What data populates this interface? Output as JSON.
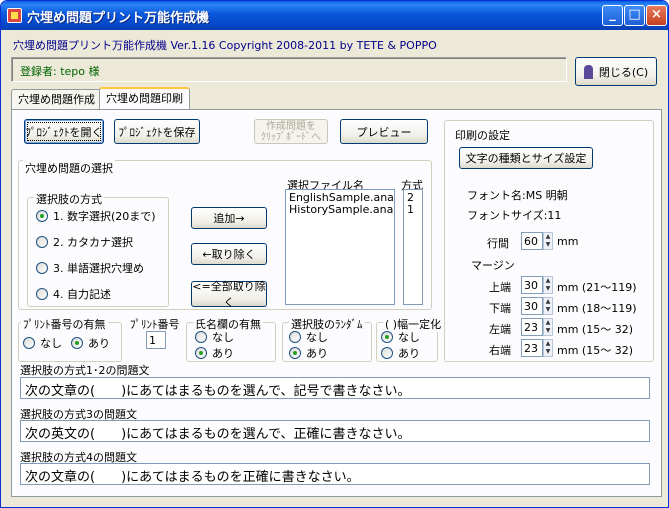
{
  "window": {
    "title": "穴埋め問題プリント万能作成機"
  },
  "header": {
    "line": "穴埋め問題プリント万能作成機 Ver.1.16  Copyright 2008-2011 by TETE & POPPO",
    "registered": "登録者: tepo 様",
    "close_button": "閉じる(C)"
  },
  "tabs": [
    {
      "label": "穴埋め問題作成"
    },
    {
      "label": "穴埋め問題印刷"
    }
  ],
  "toolbar": {
    "open_project": "ﾌﾟﾛｼﾞｪｸﾄを開く",
    "save_project": "ﾌﾟﾛｼﾞｪｸﾄを保存",
    "clipboard_line1": "作成問題を",
    "clipboard_line2": "ｸﾘｯﾌﾟﾎﾞｰﾄﾞへ",
    "preview": "プレビュー"
  },
  "selection": {
    "group_title": "穴埋め問題の選択",
    "method_group_title": "選択肢の方式",
    "methods": [
      "1. 数字選択(20まで)",
      "2. カタカナ選択",
      "3. 単語選択穴埋め",
      "4. 自力記述"
    ],
    "add": "追加→",
    "remove": "←取り除く",
    "remove_all": "<=全部取り除く",
    "files_header": "選択ファイル名",
    "method_header": "方式",
    "files": [
      "EnglishSample.ana",
      "HistorySample.ana"
    ],
    "file_methods": [
      "2",
      "1"
    ]
  },
  "options": {
    "print_number_title": "ﾌﾟﾘﾝﾄ番号の有無",
    "none": "なし",
    "yes": "あり",
    "print_no_title": "ﾌﾟﾘﾝﾄ番号",
    "print_no_value": "1",
    "name_field_title": "氏名欄の有無",
    "random_title": "選択肢のﾗﾝﾀﾞﾑ",
    "fixed_width_title": "( )幅一定化"
  },
  "print_settings": {
    "title": "印刷の設定",
    "font_button": "文字の種類とサイズ設定",
    "font_name": "フォント名:MS 明朝",
    "font_size": "フォントサイズ:11",
    "line_spacing_label": "行間",
    "line_spacing_value": "60",
    "unit": "mm",
    "margin_label": "マージン",
    "margins": [
      {
        "label": "上端",
        "value": "30",
        "range": "mm (21～119)"
      },
      {
        "label": "下端",
        "value": "30",
        "range": "mm (18～119)"
      },
      {
        "label": "左端",
        "value": "23",
        "range": "mm (15～ 32)"
      },
      {
        "label": "右端",
        "value": "23",
        "range": "mm (15～ 32)"
      }
    ]
  },
  "questions": [
    {
      "label": "選択肢の方式1･2の問題文",
      "value": "次の文章の(　　)にあてはまるものを選んで、記号で書きなさい。"
    },
    {
      "label": "選択肢の方式3の問題文",
      "value": "次の英文の(　　)にあてはまるものを選んで、正確に書きなさい。"
    },
    {
      "label": "選択肢の方式4の問題文",
      "value": "次の文章の(　　)にあてはまるものを正確に書きなさい。"
    }
  ]
}
